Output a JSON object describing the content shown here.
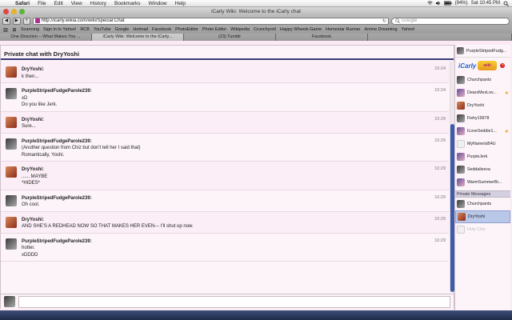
{
  "menubar": {
    "apple_glyph": "",
    "items": [
      "Safari",
      "File",
      "Edit",
      "View",
      "History",
      "Bookmarks",
      "Window",
      "Help"
    ],
    "battery": "(94%)",
    "clock": "Sat 10:45 PM"
  },
  "window": {
    "title": "iCarly Wiki: Welcome to the iCarly chat"
  },
  "toolbar": {
    "back": "◀",
    "forward": "▶",
    "add": "+",
    "url": "http://icarly.wikia.com/wiki/Special:Chat",
    "search_placeholder": "Google"
  },
  "bookmarks": {
    "items": [
      "Scanning",
      "Sign in to Yahoo!",
      "RCB",
      "YouTube",
      "Google",
      "Hotmail",
      "Facebook",
      "PhotoEditor",
      "Photo Editor",
      "Wikipedia",
      "Crunchyroll",
      "Happy Wheels Game",
      "Homestar Runner",
      "Anime Dreaming",
      "Yahoo!"
    ]
  },
  "tabs": [
    {
      "label": "One Direction – What Makes You ...",
      "active": false
    },
    {
      "label": "iCarly Wiki: Welcome to the iCarly...",
      "active": true
    },
    {
      "label": "(23) Tumblr",
      "active": false
    },
    {
      "label": "Facebook",
      "active": false
    }
  ],
  "chat": {
    "header": "Private chat with DryYoshi",
    "messages": [
      {
        "author": "DryYoshi:",
        "lines": [
          "k then..."
        ],
        "time": "10:24",
        "avatar": "red"
      },
      {
        "author": "PurpleStripedFudgeParole239:",
        "lines": [
          "xD",
          "Do you like Jerk."
        ],
        "time": "10:24",
        "avatar": "dark"
      },
      {
        "author": "DryYoshi:",
        "lines": [
          "Sure..."
        ],
        "time": "10:29",
        "avatar": "red"
      },
      {
        "author": "PurpleStripedFudgeParole239:",
        "lines": [
          "(Another question from Chiz but don't tell her I said that)",
          "Romantically, Yoshi."
        ],
        "time": "10:29",
        "avatar": "dark"
      },
      {
        "author": "DryYoshi:",
        "lines": [
          "...... MAYBE",
          "*HIDES*"
        ],
        "time": "10:29",
        "avatar": "red"
      },
      {
        "author": "PurpleStripedFudgeParole239:",
        "lines": [
          "Oh cool."
        ],
        "time": "10:29",
        "avatar": "dark"
      },
      {
        "author": "DryYoshi:",
        "lines": [
          "AND SHE'S A REDHEAD NOW SO THAT MAKES HER EVEN--- I'll shut up now."
        ],
        "time": "10:29",
        "avatar": "red"
      },
      {
        "author": "PurpleStripedFudgeParole239:",
        "lines": [
          "hotter.",
          "xDDDD"
        ],
        "time": "10:29",
        "avatar": "dark"
      }
    ],
    "input_value": ""
  },
  "sidebar": {
    "me": "PurpleStripedFudg...",
    "logo_text": "iCarly",
    "logo_tag": "wiki",
    "logo_badge": "?",
    "users": [
      {
        "name": "Churchpants",
        "star": false,
        "avatar": "dark"
      },
      {
        "name": "DearxMexLov...",
        "star": true,
        "avatar": "multi"
      },
      {
        "name": "DryYoshi",
        "star": false,
        "avatar": "red"
      },
      {
        "name": "Fishy19978",
        "star": false,
        "avatar": "dark"
      },
      {
        "name": "ILoveSeddie1...",
        "star": true,
        "avatar": "multi"
      },
      {
        "name": "MyNameIsB4U",
        "star": false,
        "avatar": "blank"
      },
      {
        "name": "PurpleJerk",
        "star": false,
        "avatar": "multi"
      },
      {
        "name": "Seddaliseva",
        "star": false,
        "avatar": "dark"
      },
      {
        "name": "WarmSummerBr...",
        "star": false,
        "avatar": "multi"
      }
    ],
    "private_heading": "Private Messages",
    "private": [
      {
        "name": "Churchpants",
        "selected": false,
        "faded": false,
        "avatar": "dark"
      },
      {
        "name": "DryYoshi",
        "selected": true,
        "faded": false,
        "avatar": "red"
      },
      {
        "name": "Holy Chiz",
        "selected": false,
        "faded": true,
        "avatar": "blank"
      }
    ],
    "star_glyph": "★"
  }
}
